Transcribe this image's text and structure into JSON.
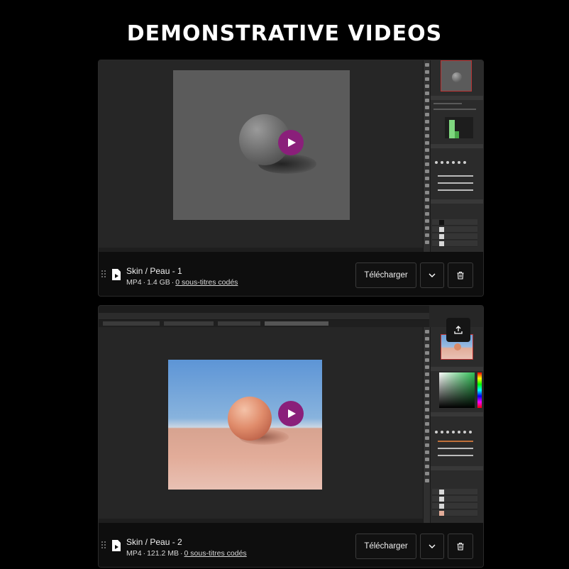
{
  "page": {
    "title": "DEMONSTRATIVE VIDEOS"
  },
  "videos": [
    {
      "name": "Skin / Peau - 1",
      "format": "MP4",
      "size": "1.4 GB",
      "subtitles": "0 sous-titres codés",
      "download_label": "Télécharger",
      "icons": {
        "play": "play-icon",
        "file": "video-file-icon",
        "expand": "chevron-down-icon",
        "delete": "trash-icon",
        "drag": "drag-handle-icon"
      }
    },
    {
      "name": "Skin / Peau - 2",
      "format": "MP4",
      "size": "121.2 MB",
      "subtitles": "0 sous-titres codés",
      "download_label": "Télécharger",
      "icons": {
        "play": "play-icon",
        "file": "video-file-icon",
        "expand": "chevron-down-icon",
        "delete": "trash-icon",
        "drag": "drag-handle-icon",
        "upload": "upload-icon"
      }
    }
  ],
  "colors": {
    "background": "#000000",
    "card": "#0e0e0e",
    "play_accent": "#8a1f7a",
    "gray_canvas": "#5b5b5b",
    "sky": "#5d95d6",
    "ground": "#e2ac99"
  },
  "separator": "·"
}
